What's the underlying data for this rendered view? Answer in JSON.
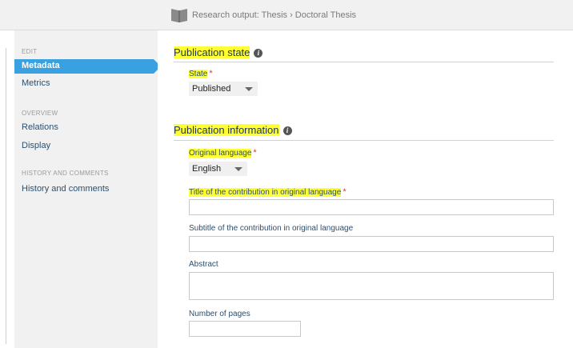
{
  "header": {
    "icon": "book-icon",
    "breadcrumb": "Research output: Thesis › Doctoral Thesis"
  },
  "sidebar": {
    "sections": [
      {
        "heading": "EDIT",
        "items": [
          "Metadata",
          "Metrics"
        ]
      },
      {
        "heading": "OVERVIEW",
        "items": [
          "Relations",
          "Display"
        ]
      },
      {
        "heading": "HISTORY AND COMMENTS",
        "items": [
          "History and comments"
        ]
      }
    ],
    "active_item": "Metadata"
  },
  "main": {
    "publication_state": {
      "title": "Publication state",
      "state_label": "State",
      "state_value": "Published"
    },
    "publication_information": {
      "title": "Publication information",
      "original_language_label": "Original language",
      "original_language_value": "English",
      "title_label": "Title of the contribution in original language",
      "title_value": "",
      "subtitle_label": "Subtitle of the contribution in original language",
      "subtitle_value": "",
      "abstract_label": "Abstract",
      "abstract_value": "",
      "pages_label": "Number of pages",
      "pages_value": ""
    },
    "required_marker": "*",
    "info_glyph": "i"
  },
  "colors": {
    "highlight": "#ffff33",
    "active_item_bg": "#3aa1e0",
    "required": "#d23c3c"
  }
}
